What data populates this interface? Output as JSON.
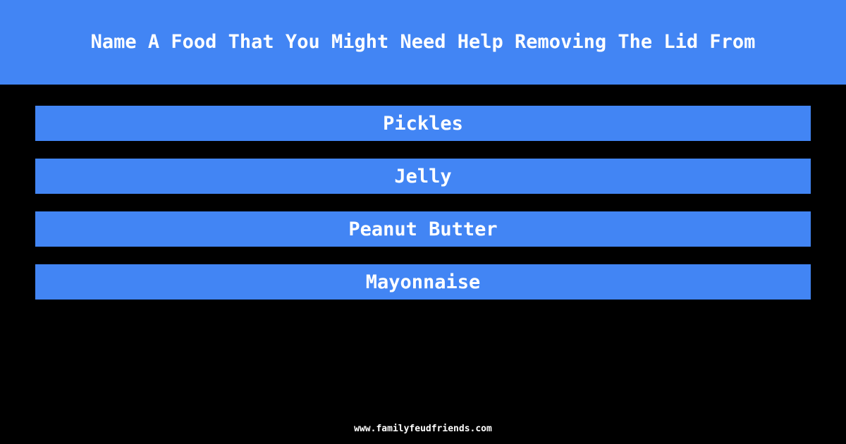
{
  "colors": {
    "background": "#000000",
    "accent": "#4285f4",
    "text_on_accent": "#ffffff",
    "footer_text": "#ffffff"
  },
  "header": {
    "question": "Name A Food That You Might Need Help Removing The Lid From"
  },
  "answers": {
    "items": [
      {
        "label": "Pickles"
      },
      {
        "label": "Jelly"
      },
      {
        "label": "Peanut Butter"
      },
      {
        "label": "Mayonnaise"
      }
    ]
  },
  "footer": {
    "site": "www.familyfeudfriends.com"
  }
}
